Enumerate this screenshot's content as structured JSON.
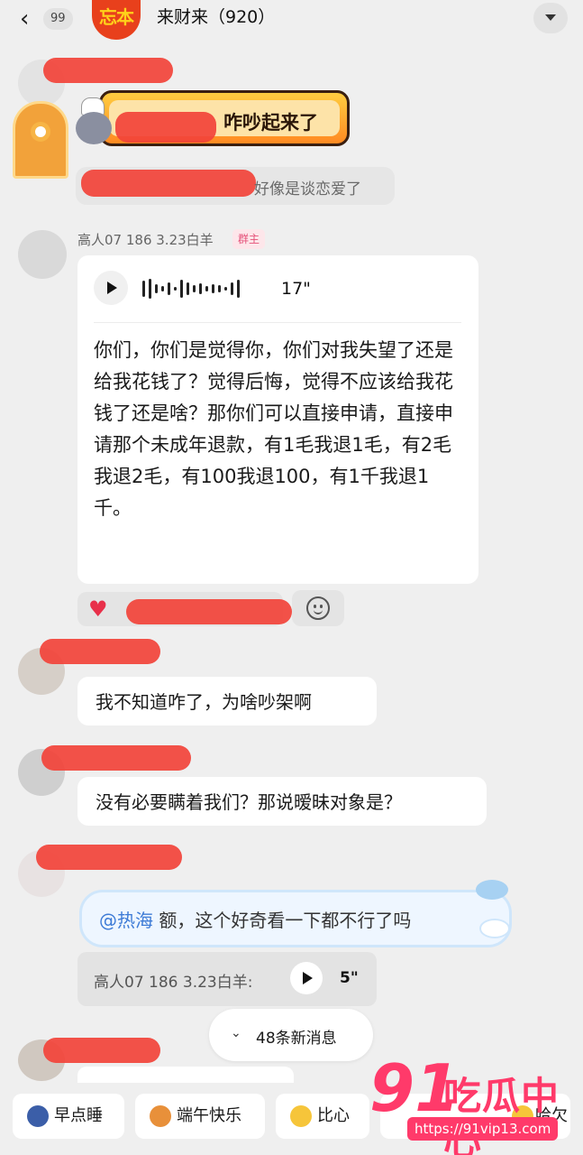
{
  "header": {
    "back_count": "99",
    "group_avatar_text": "忘本",
    "title": "来财来（920）"
  },
  "messages": {
    "special_card_text": "咋吵起来了",
    "hint_text": "好像是谈恋爱了",
    "owner": {
      "name": "高人07 186 3.23白羊",
      "badge": "群主",
      "voice_duration": "17\"",
      "transcript": "你们，你们是觉得你，你们对我失望了还是给我花钱了？觉得后悔，觉得不应该给我花钱了还是啥？那你们可以直接申请，直接申请那个未成年退款，有1毛我退1毛，有2毛我退2毛，有100我退100，有1千我退1千。"
    },
    "msg1": "我不知道咋了，为啥吵架啊",
    "msg2": "没有必要瞒着我们？那说暧昧对象是？",
    "msg3": {
      "at": "@热海",
      "text": " 额，这个好奇看一下都不行了吗"
    },
    "quote": {
      "sender": "高人07 186 3.23白羊:",
      "duration": "5\""
    }
  },
  "new_messages": "48条新消息",
  "quick_replies": [
    "早点睡",
    "端午快乐",
    "比心",
    "哈欠"
  ],
  "watermark": {
    "big": "91",
    "cn": "吃瓜中心",
    "url": "https://91vip13.com"
  }
}
